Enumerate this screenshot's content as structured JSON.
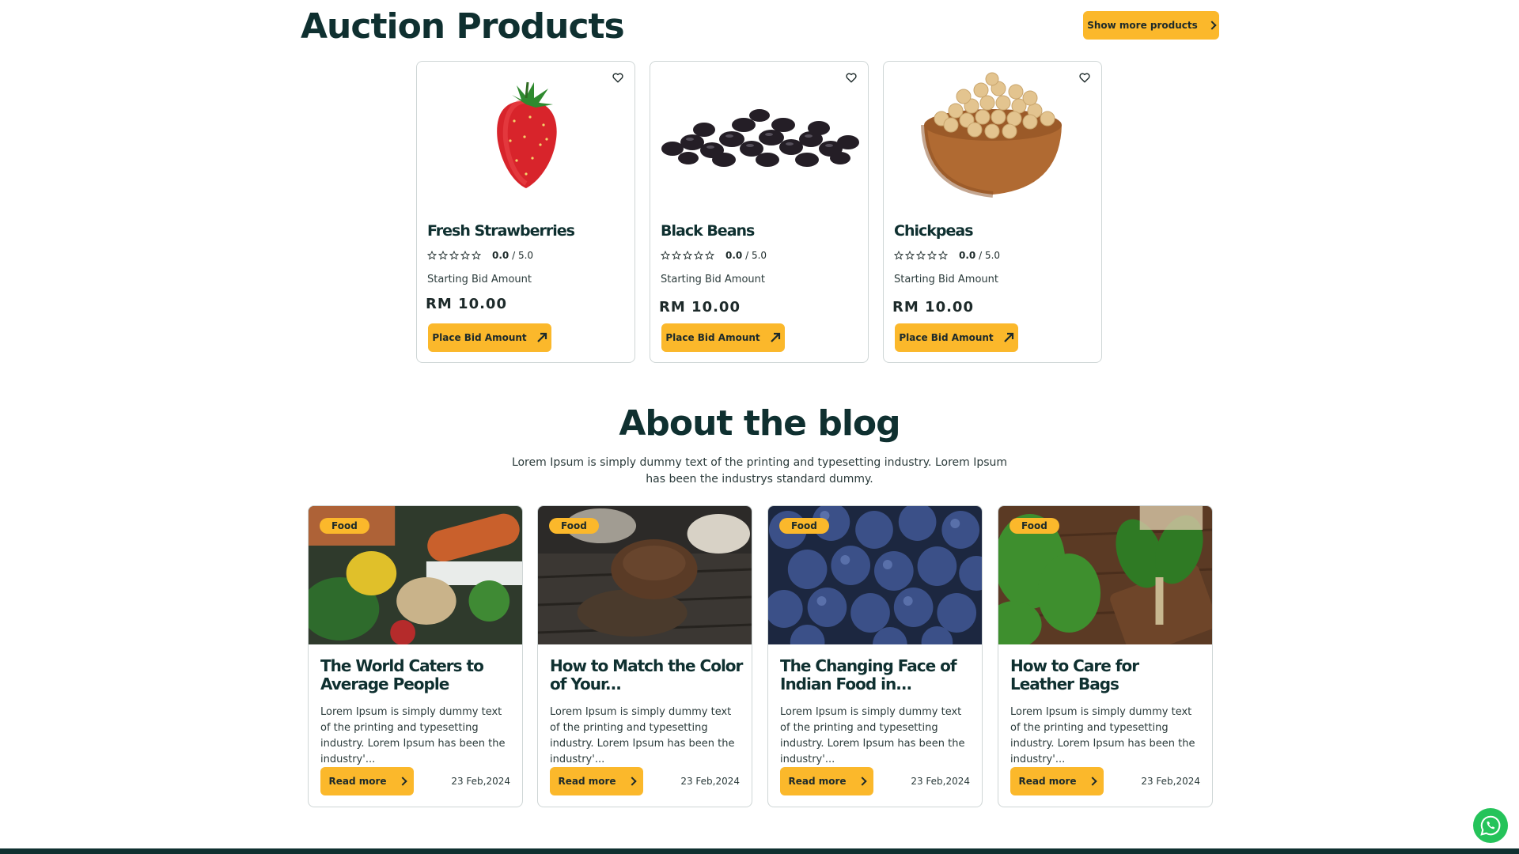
{
  "auction": {
    "title": "Auction Products",
    "show_more_label": "Show more products",
    "products": [
      {
        "name": "Fresh Strawberries",
        "rating": "0.0",
        "rating_max": "/ 5.0",
        "bid_label": "Starting Bid Amount",
        "bid_amount": "RM 10.00",
        "button_label": "Place Bid Amount",
        "image": "strawberry"
      },
      {
        "name": "Black Beans",
        "rating": "0.0",
        "rating_max": "/ 5.0",
        "bid_label": "Starting Bid Amount",
        "bid_amount": "RM 10.00",
        "button_label": "Place Bid Amount",
        "image": "black-beans"
      },
      {
        "name": "Chickpeas",
        "rating": "0.0",
        "rating_max": "/ 5.0",
        "bid_label": "Starting Bid Amount",
        "bid_amount": "RM 10.00",
        "button_label": "Place Bid Amount",
        "image": "chickpeas"
      }
    ]
  },
  "blog": {
    "title": "About the blog",
    "subtitle": "Lorem Ipsum is simply dummy text of the printing and typesetting industry. Lorem Ipsum has been the industrys standard dummy.",
    "posts": [
      {
        "tag": "Food",
        "title": "The World Caters to Average People",
        "excerpt": "Lorem Ipsum is simply dummy text of the printing and typesetting industry. Lorem Ipsum has been the industry'...",
        "read_more": "Read more",
        "date": "23 Feb,2024",
        "image": "vegetables"
      },
      {
        "tag": "Food",
        "title": "How to Match the Color of Your...",
        "excerpt": "Lorem Ipsum is simply dummy text of the printing and typesetting industry. Lorem Ipsum has been the industry'...",
        "read_more": "Read more",
        "date": "23 Feb,2024",
        "image": "bread"
      },
      {
        "tag": "Food",
        "title": "The Changing Face of Indian Food in...",
        "excerpt": "Lorem Ipsum is simply dummy text of the printing and typesetting industry. Lorem Ipsum has been the industry'...",
        "read_more": "Read more",
        "date": "23 Feb,2024",
        "image": "blueberries"
      },
      {
        "tag": "Food",
        "title": "How to Care for Leather Bags",
        "excerpt": "Lorem Ipsum is simply dummy text of the printing and typesetting industry. Lorem Ipsum has been the industry'...",
        "read_more": "Read more",
        "date": "23 Feb,2024",
        "image": "spinach"
      }
    ]
  },
  "colors": {
    "accent": "#fbb82b",
    "heading": "#0f3030",
    "whatsapp": "#25c35a"
  },
  "icons": {
    "wishlist": "heart-icon",
    "arrow": "chevron-right-icon",
    "bid": "arrow-up-right-icon",
    "chat": "whatsapp-icon"
  }
}
